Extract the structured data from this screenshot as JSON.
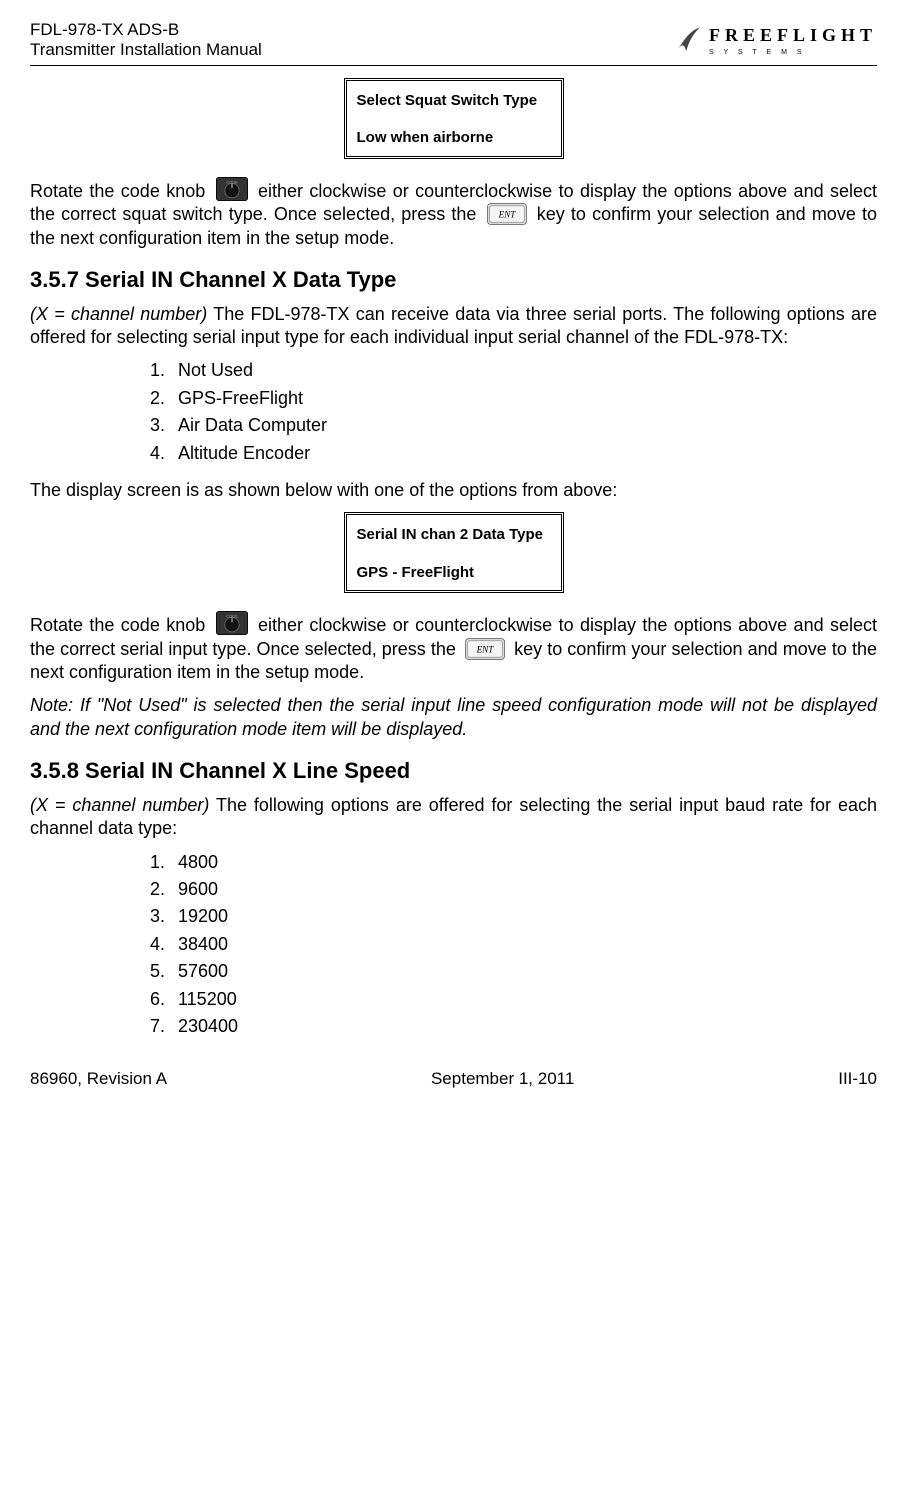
{
  "header": {
    "line1": "FDL-978-TX ADS-B",
    "line2": "Transmitter Installation Manual",
    "logo_main": "FREEFLIGHT",
    "logo_sub": "S Y S T E M S"
  },
  "display1": {
    "title": "Select Squat Switch Type",
    "value": "Low when airborne"
  },
  "text": {
    "rotate_pre": "Rotate the code knob",
    "rotate_post1": "either clockwise or counterclockwise to display the options above and select the correct squat switch type. Once selected, press the ",
    "rotate_end1": " key to confirm your selection and move to the next configuration item in the setup mode.",
    "rotate_post2": "either clockwise or counterclockwise to display the options above and select the correct serial input type. Once selected, press the ",
    "rotate_end2": " key to confirm your selection and move to the next configuration item in the setup mode.",
    "note": "Note: If \"Not Used\" is selected then the serial input line speed configuration mode will not be displayed and the next configuration mode item will be displayed.",
    "display_screen": "The display screen is as shown below with one of the options from above:"
  },
  "section357": {
    "title": "3.5.7  Serial IN Channel X Data Type",
    "para": "(X = channel number) The FDL-978-TX can receive data via three serial ports. The following options are offered for selecting serial input type for each individual input serial channel of the FDL-978-TX:",
    "options": [
      "Not Used",
      "GPS-FreeFlight",
      "Air Data Computer",
      "Altitude Encoder"
    ]
  },
  "display2": {
    "title": "Serial IN chan 2 Data Type",
    "value": "GPS - FreeFlight"
  },
  "section358": {
    "title": "3.5.8  Serial IN Channel X Line Speed",
    "para": "(X = channel number) The following options are offered for selecting the serial input baud rate for each channel data type:",
    "options": [
      "4800",
      "9600",
      "19200",
      "38400",
      "57600",
      "115200",
      "230400"
    ]
  },
  "footer": {
    "left": "86960, Revision A",
    "center": "September 1, 2011",
    "right": "III-10"
  }
}
